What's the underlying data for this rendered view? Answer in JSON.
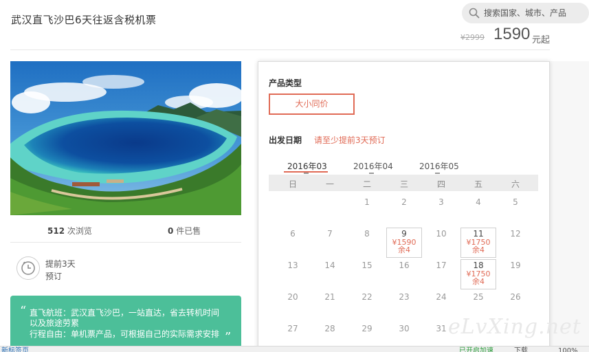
{
  "header": {
    "title": "武汉直飞沙巴6天往返含税机票",
    "search_placeholder": "搜索国家、城市、产品",
    "old_price": "¥2999",
    "price": "1590",
    "price_suffix": "元起"
  },
  "stats": {
    "views_count": "512",
    "views_label": "次浏览",
    "sold_count": "0",
    "sold_label": "件已售"
  },
  "advance": {
    "line1": "提前3天",
    "line2": "预订"
  },
  "highlight": {
    "line1": "直飞航班：武汉直飞沙巴，一站直达，省去转机时间",
    "line2": "以及旅途劳累",
    "line3": "行程自由：单机票产品，可根据自己的实际需求安排"
  },
  "product_type": {
    "label": "产品类型",
    "option": "大小同价"
  },
  "departure": {
    "label": "出发日期",
    "note": "请至少提前3天预订"
  },
  "months": [
    "2016年03",
    "2016年04",
    "2016年05"
  ],
  "weekdays": [
    "日",
    "一",
    "二",
    "三",
    "四",
    "五",
    "六"
  ],
  "calendar": {
    "row1": [
      "1",
      "2",
      "3",
      "4",
      "5"
    ],
    "row2": [
      "6",
      "7",
      "8",
      "9",
      "10",
      "11",
      "12"
    ],
    "row3": [
      "13",
      "14",
      "15",
      "16",
      "17",
      "18",
      "19"
    ],
    "row4": [
      "20",
      "21",
      "22",
      "23",
      "24",
      "25",
      "26"
    ],
    "row5": [
      "27",
      "28",
      "29",
      "30",
      "31"
    ],
    "available": {
      "d9": {
        "price": "¥1590",
        "remain": "余4"
      },
      "d11": {
        "price": "¥1750",
        "remain": "余4"
      },
      "d18": {
        "price": "¥1750",
        "remain": "余4"
      }
    }
  },
  "watermark": "eLvXing.net",
  "statusbar": {
    "left": "新标签页",
    "mid": "已开启加速",
    "r1": "下载",
    "r2": "100%"
  },
  "colors": {
    "accent": "#e06a55",
    "green": "#4cbf99"
  }
}
